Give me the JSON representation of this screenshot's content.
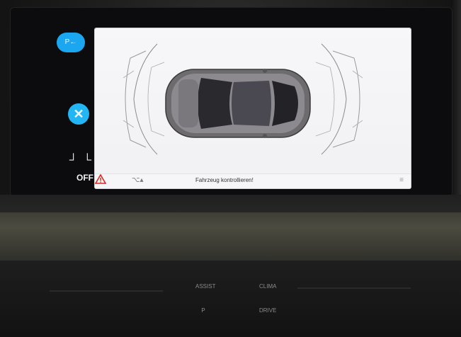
{
  "left_panel": {
    "park_button_label": "P←",
    "close_button_label": "✕",
    "seat_icons": "┘ └",
    "off_label": "OFF"
  },
  "status_bar": {
    "control_glyph": "⌥▴",
    "warning_text": "Fahrzeug kontrollieren!",
    "menu_glyph": "≡"
  },
  "colors": {
    "accent_blue": "#1aa7ef",
    "warning_red": "#e0271f",
    "screen_bg": "#f4f4f6"
  },
  "console": {
    "buttons": [
      "ASSIST",
      "CLIMA",
      "P",
      "DRIVE"
    ]
  }
}
